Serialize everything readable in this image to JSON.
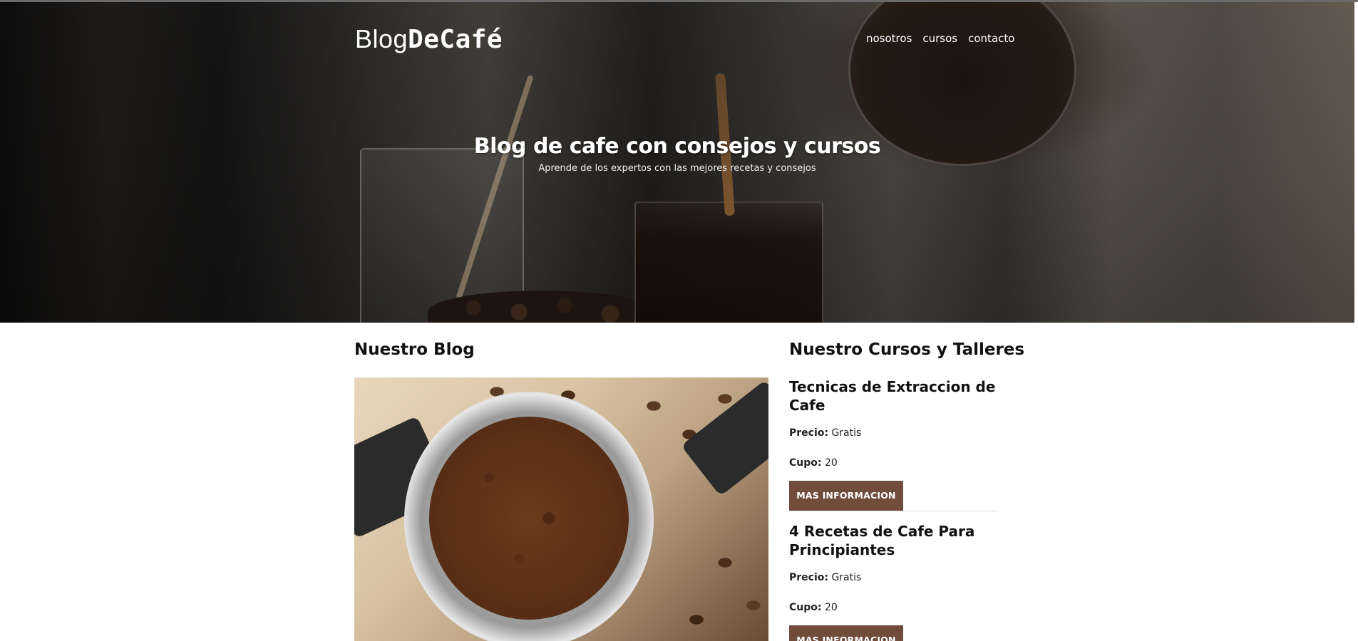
{
  "header": {
    "brand_light": "Blog",
    "brand_bold": "DeCafé",
    "nav": [
      "nosotros",
      "cursos",
      "contacto"
    ]
  },
  "hero": {
    "title": "Blog de cafe con consejos y cursos",
    "subtitle": "Aprende de los expertos con las mejores recetas y consejos"
  },
  "blog": {
    "title": "Nuestro Blog"
  },
  "courses": {
    "title": "Nuestro Cursos y Talleres",
    "items": [
      {
        "name": "Tecnicas de Extraccion de Cafe",
        "price_label": "Precio:",
        "price": "Gratis",
        "capacity_label": "Cupo:",
        "capacity": "20",
        "button": "MAS INFORMACION"
      },
      {
        "name": "4 Recetas de Cafe Para Principiantes",
        "price_label": "Precio:",
        "price": "Gratis",
        "capacity_label": "Cupo:",
        "capacity": "20",
        "button": "MAS INFORMACION"
      }
    ]
  },
  "colors": {
    "button_bg": "#714c3c",
    "text": "#111111"
  }
}
